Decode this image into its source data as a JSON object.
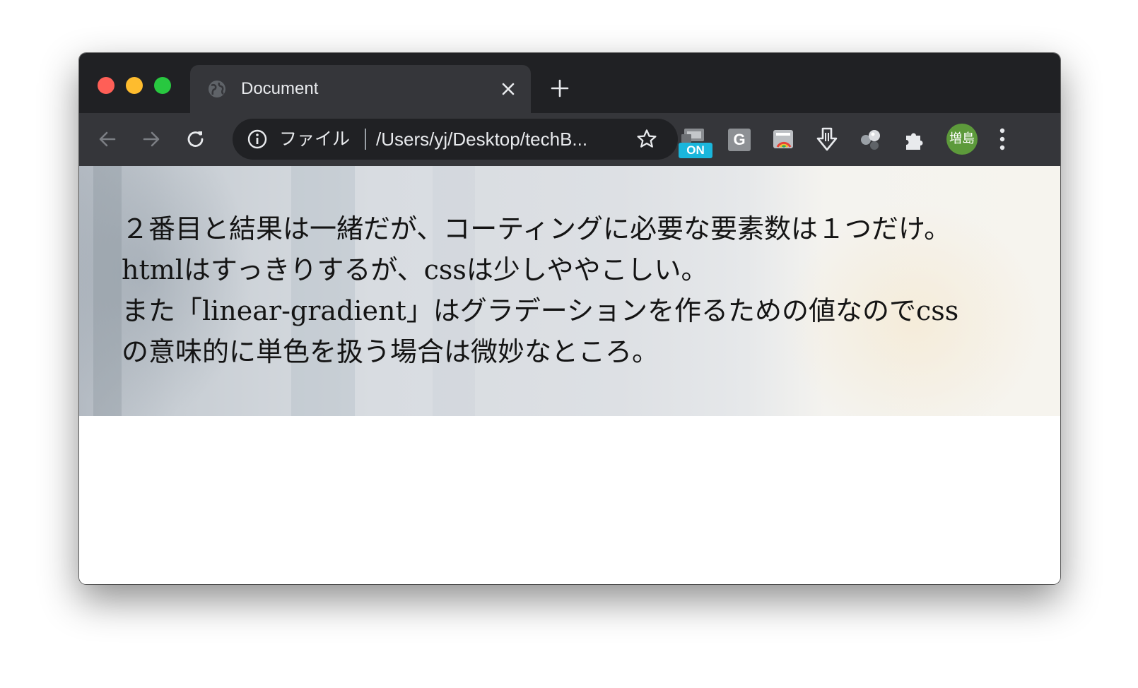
{
  "browser": {
    "tab": {
      "title": "Document"
    },
    "omnibox": {
      "scheme_label": "ファイル",
      "url": "/Users/yj/Desktop/techB..."
    },
    "extensions": {
      "on_badge": "ON",
      "g_label": "G"
    },
    "profile": {
      "initials": "増島"
    }
  },
  "page": {
    "lines": [
      "２番目と結果は一緒だが、コーティングに必要な要素数は１つだけ。",
      "htmlはすっきりするが、cssは少しややこしい。",
      "また「linear-gradient」はグラデーションを作るための値なのでcss",
      "の意味的に単色を扱う場合は微妙なところ。"
    ]
  }
}
